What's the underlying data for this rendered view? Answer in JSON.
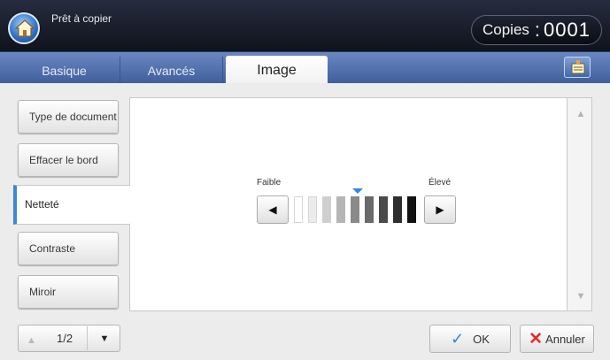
{
  "header": {
    "status_text": "Prêt à copier",
    "copies_label": "Copies",
    "copies_separator": ":",
    "copies_value": "0001"
  },
  "tabs": [
    {
      "label": "Basique"
    },
    {
      "label": "Avancés"
    },
    {
      "label": "Image",
      "active": true
    }
  ],
  "sidebar": {
    "items": [
      {
        "label": "Type de document"
      },
      {
        "label": "Effacer le bord"
      },
      {
        "label": "Netteté",
        "active": true
      },
      {
        "label": "Contraste"
      },
      {
        "label": "Miroir"
      }
    ]
  },
  "sharpness": {
    "low_label": "Faible",
    "high_label": "Élevé",
    "level": 5,
    "max_level": 9,
    "colors": [
      "#ffffff",
      "#ebebeb",
      "#cfcfcf",
      "#b5b5b5",
      "#8a8a8a",
      "#6a6a6a",
      "#4a4a4a",
      "#2e2e2e",
      "#111111"
    ]
  },
  "pager": {
    "text": "1/2"
  },
  "actions": {
    "ok_label": "OK",
    "cancel_label": "Annuler"
  },
  "icons": {
    "home": "home-icon",
    "tab_menu": "settings-list-icon"
  },
  "colors": {
    "accent": "#3b86d6",
    "cancel_red": "#e52a2a",
    "tab_bar": "#5877b4"
  }
}
